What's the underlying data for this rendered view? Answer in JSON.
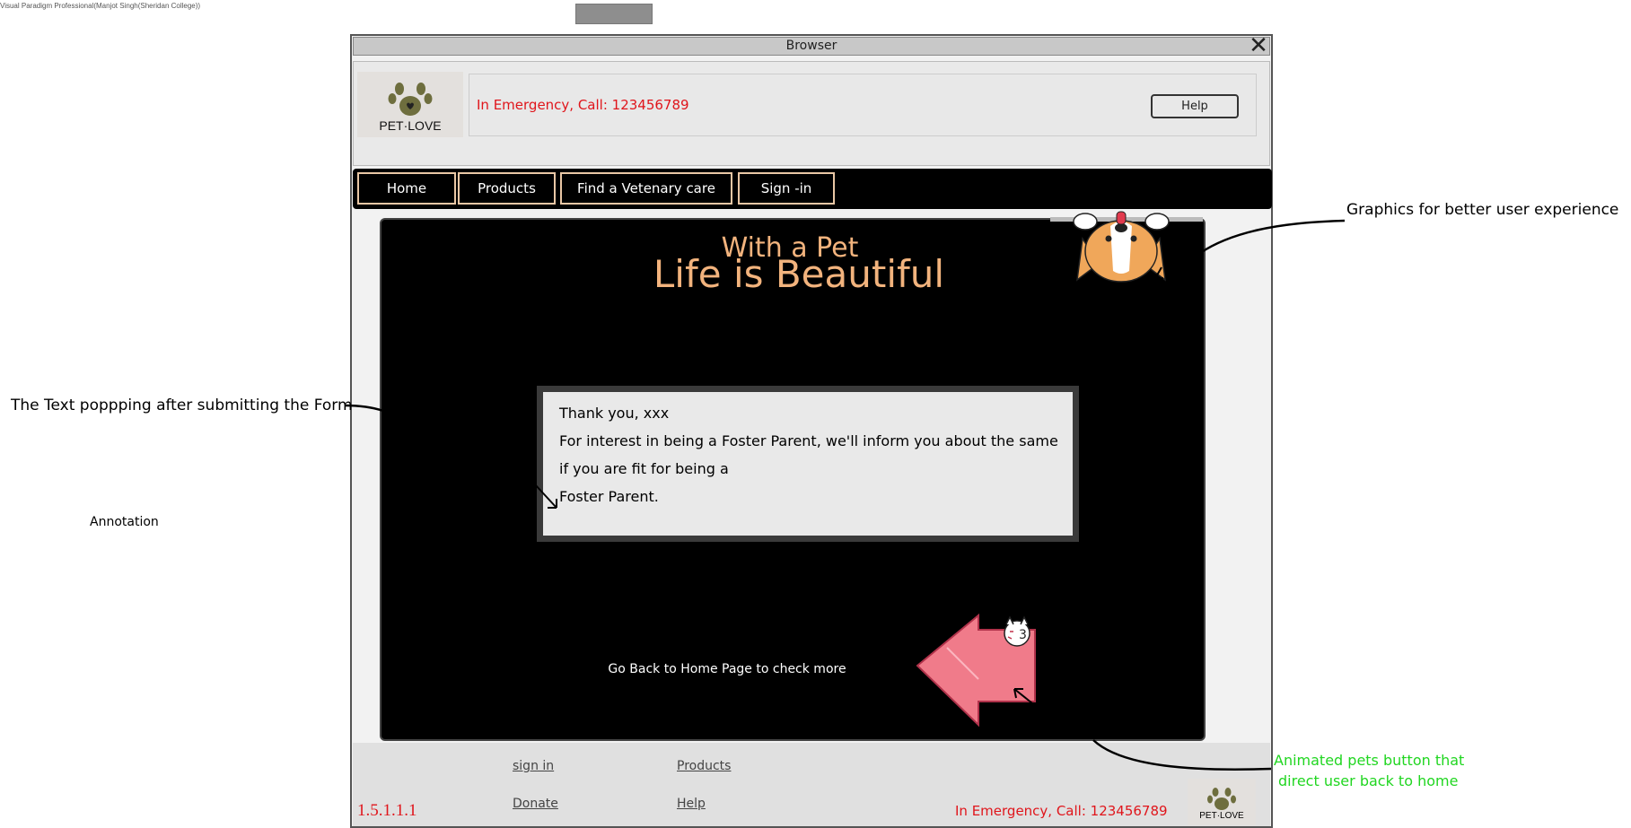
{
  "app": {
    "watermark": "Visual Paradigm Professional(Manjot Singh(Sheridan College))",
    "window_title": "Browser"
  },
  "header": {
    "logo_text": "PET·LOVE",
    "emergency": "In Emergency, Call: 123456789",
    "help_label": "Help"
  },
  "nav": {
    "items": [
      {
        "label": "Home"
      },
      {
        "label": "Products"
      },
      {
        "label": "Find a Vetenary care"
      },
      {
        "label": "Sign -in"
      }
    ]
  },
  "hero": {
    "title_line1": "With a Pet",
    "title_line2": "Life is Beautiful",
    "message": {
      "line1": "Thank you, xxx",
      "line2": "For interest in being a Foster Parent, we'll inform you about the same",
      "line3": "if you are fit for being a",
      "line4": "Foster Parent."
    },
    "go_back_text": "Go Back to Home Page to check more"
  },
  "footer": {
    "links": [
      {
        "label": "sign in"
      },
      {
        "label": "Products"
      },
      {
        "label": "Donate"
      },
      {
        "label": "Help"
      }
    ],
    "version": "1.5.1.1.1",
    "emergency": "In Emergency, Call: 123456789",
    "logo_text": "PET·LOVE"
  },
  "annotations": {
    "graphics": "Graphics for better user experience",
    "text_popping": "The Text poppping after submitting the Form",
    "label": "Annotation",
    "animated_line1": "Animated pets  button that",
    "animated_line2": "direct user back to home"
  },
  "colors": {
    "accent_orange": "#f2b37d",
    "emergency_red": "#e0151b",
    "annotation_green": "#21d621",
    "arrow_pink": "#f07b8a"
  }
}
